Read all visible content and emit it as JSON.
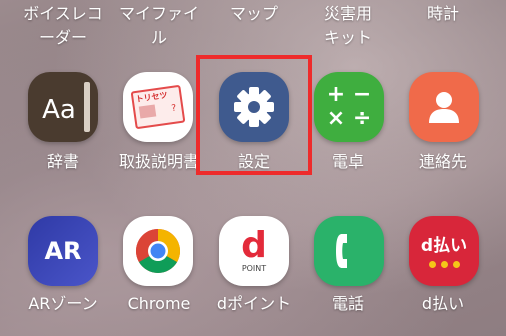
{
  "top_row": [
    {
      "label": "ボイスレコ\nーダー"
    },
    {
      "label": "マイファイ\nル"
    },
    {
      "label": "マップ"
    },
    {
      "label": "災害用\nキット"
    },
    {
      "label": "時計"
    }
  ],
  "row1": [
    {
      "label": "辞書",
      "icon": "dictionary-icon",
      "glyph": "Aa"
    },
    {
      "label": "取扱説明書",
      "icon": "manual-icon",
      "glyph": "トリセツ"
    },
    {
      "label": "設定",
      "icon": "gear-icon"
    },
    {
      "label": "電卓",
      "icon": "calculator-icon",
      "glyph_top": "+ −",
      "glyph_bottom": "× ÷"
    },
    {
      "label": "連絡先",
      "icon": "contacts-icon"
    }
  ],
  "row2": [
    {
      "label": "ARゾーン",
      "icon": "ar-icon",
      "glyph": "AR"
    },
    {
      "label": "Chrome",
      "icon": "chrome-icon"
    },
    {
      "label": "dポイント",
      "icon": "dpoint-icon",
      "glyph": "d",
      "glyph_sub": "POINT"
    },
    {
      "label": "電話",
      "icon": "phone-icon"
    },
    {
      "label": "d払い",
      "icon": "dpay-icon",
      "glyph": "d払い"
    }
  ],
  "colors": {
    "highlight": "#ee2b2b",
    "settings_bg": "#3f5a8e",
    "calculator_bg": "#3fae3f",
    "contacts_bg": "#f06a4a",
    "dictionary_bg": "#4a3b2f",
    "phone_bg": "#2ab26a",
    "dpay_bg": "#d8263a",
    "ar_bg": "#3a3fb3"
  }
}
